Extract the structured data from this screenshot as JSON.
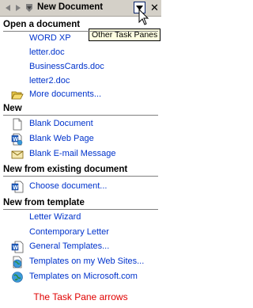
{
  "pane": {
    "title": "New Document",
    "tooltip": "Other Task Panes"
  },
  "sections": {
    "open": {
      "heading": "Open a document",
      "recent": [
        "WORD XP",
        "letter.doc",
        "BusinessCards.doc",
        "letter2.doc"
      ],
      "more": "More documents..."
    },
    "new": {
      "heading": "New",
      "items": [
        "Blank Document",
        "Blank Web Page",
        "Blank E-mail Message"
      ]
    },
    "existing": {
      "heading": "New from existing document",
      "items": [
        "Choose document..."
      ]
    },
    "template": {
      "heading": "New from template",
      "items": [
        "Letter Wizard",
        "Contemporary Letter",
        "General Templates...",
        "Templates on my Web Sites...",
        "Templates on Microsoft.com"
      ]
    }
  },
  "caption": "The Task Pane arrows",
  "colors": {
    "link": "#0033cc",
    "caption": "#e00000",
    "titlebar": "#d4d0c8"
  }
}
